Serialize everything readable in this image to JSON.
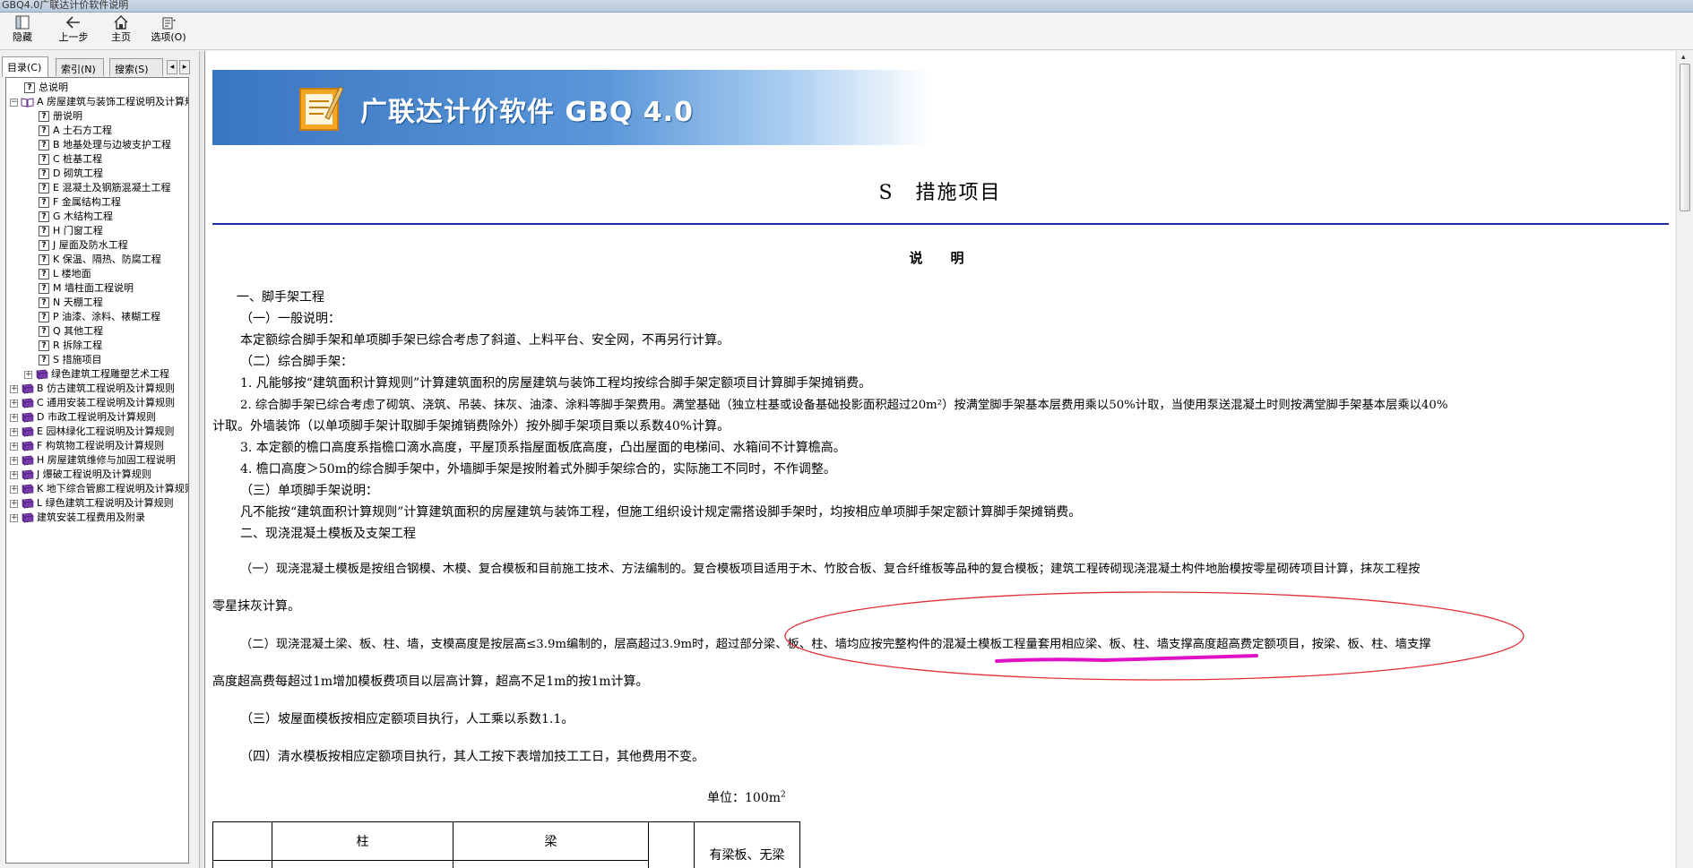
{
  "window": {
    "title": "GBQ4.0广联达计价软件说明"
  },
  "toolbar": {
    "hide_label": "隐藏",
    "back_label": "上一步",
    "home_label": "主页",
    "options_label": "选项(O)"
  },
  "left_tabs": {
    "contents": "目录(C)",
    "index": "索引(N)",
    "search": "搜索(S)"
  },
  "tree": [
    {
      "label": "总说明",
      "level": 1,
      "icon": "help-page-icon",
      "exp": ""
    },
    {
      "label": "A 房屋建筑与装饰工程说明及计算规则",
      "level": 0,
      "icon": "open-book-icon",
      "exp": "−"
    },
    {
      "label": "册说明",
      "level": 2,
      "icon": "help-page-icon",
      "exp": ""
    },
    {
      "label": "A 土石方工程",
      "level": 2,
      "icon": "help-page-icon",
      "exp": ""
    },
    {
      "label": "B 地基处理与边坡支护工程",
      "level": 2,
      "icon": "help-page-icon",
      "exp": ""
    },
    {
      "label": "C 桩基工程",
      "level": 2,
      "icon": "help-page-icon",
      "exp": ""
    },
    {
      "label": "D 砌筑工程",
      "level": 2,
      "icon": "help-page-icon",
      "exp": ""
    },
    {
      "label": "E 混凝土及钢筋混凝土工程",
      "level": 2,
      "icon": "help-page-icon",
      "exp": ""
    },
    {
      "label": "F 金属结构工程",
      "level": 2,
      "icon": "help-page-icon",
      "exp": ""
    },
    {
      "label": "G 木结构工程",
      "level": 2,
      "icon": "help-page-icon",
      "exp": ""
    },
    {
      "label": "H 门窗工程",
      "level": 2,
      "icon": "help-page-icon",
      "exp": ""
    },
    {
      "label": "J 屋面及防水工程",
      "level": 2,
      "icon": "help-page-icon",
      "exp": ""
    },
    {
      "label": "K 保温、隔热、防腐工程",
      "level": 2,
      "icon": "help-page-icon",
      "exp": ""
    },
    {
      "label": "L 楼地面",
      "level": 2,
      "icon": "help-page-icon",
      "exp": ""
    },
    {
      "label": "M 墙柱面工程说明",
      "level": 2,
      "icon": "help-page-icon",
      "exp": ""
    },
    {
      "label": "N 天棚工程",
      "level": 2,
      "icon": "help-page-icon",
      "exp": ""
    },
    {
      "label": "P 油漆、涂料、裱糊工程",
      "level": 2,
      "icon": "help-page-icon",
      "exp": ""
    },
    {
      "label": "Q 其他工程",
      "level": 2,
      "icon": "help-page-icon",
      "exp": ""
    },
    {
      "label": "R 拆除工程",
      "level": 2,
      "icon": "help-page-icon",
      "exp": ""
    },
    {
      "label": "S 措施项目",
      "level": 2,
      "icon": "help-page-icon",
      "exp": ""
    },
    {
      "label": "绿色建筑工程雕塑艺术工程",
      "level": 1,
      "icon": "closed-book-icon",
      "exp": "+"
    },
    {
      "label": "B 仿古建筑工程说明及计算规则",
      "level": 0,
      "icon": "closed-book-icon",
      "exp": "+"
    },
    {
      "label": "C 通用安装工程说明及计算规则",
      "level": 0,
      "icon": "closed-book-icon",
      "exp": "+"
    },
    {
      "label": "D 市政工程说明及计算规则",
      "level": 0,
      "icon": "closed-book-icon",
      "exp": "+"
    },
    {
      "label": "E 园林绿化工程说明及计算规则",
      "level": 0,
      "icon": "closed-book-icon",
      "exp": "+"
    },
    {
      "label": "F 构筑物工程说明及计算规则",
      "level": 0,
      "icon": "closed-book-icon",
      "exp": "+"
    },
    {
      "label": "H 房屋建筑维修与加固工程说明",
      "level": 0,
      "icon": "closed-book-icon",
      "exp": "+"
    },
    {
      "label": "J 爆破工程说明及计算规则",
      "level": 0,
      "icon": "closed-book-icon",
      "exp": "+"
    },
    {
      "label": "K 地下综合管廊工程说明及计算规则",
      "level": 0,
      "icon": "closed-book-icon",
      "exp": "+"
    },
    {
      "label": "L 绿色建筑工程说明及计算规则",
      "level": 0,
      "icon": "closed-book-icon",
      "exp": "+"
    },
    {
      "label": "建筑安装工程费用及附录",
      "level": 0,
      "icon": "closed-book-icon",
      "exp": "+"
    }
  ],
  "banner": {
    "text": "广联达计价软件 GBQ 4.0"
  },
  "doc": {
    "heading": "S　措施项目",
    "subheading": "说　明",
    "paragraphs": [
      "一、脚手架工程",
      "（一）一般说明：",
      "本定额综合脚手架和单项脚手架已综合考虑了斜道、上料平台、安全网，不再另行计算。",
      "（二）综合脚手架：",
      "1. 凡能够按“建筑面积计算规则”计算建筑面积的房屋建筑与装饰工程均按综合脚手架定额项目计算脚手架摊销费。",
      "2. 综合脚手架已综合考虑了砌筑、浇筑、吊装、抹灰、油漆、涂料等脚手架费用。满堂基础（独立柱基或设备基础投影面积超过20m²）按满堂脚手架基本层费用乘以50%计取，当使用泵送混凝土时则按满堂脚手架基本层乘以40%",
      "计取。外墙装饰（以单项脚手架计取脚手架摊销费除外）按外脚手架项目乘以系数40%计算。",
      "3. 本定额的檐口高度系指檐口滴水高度，平屋顶系指屋面板底高度，凸出屋面的电梯间、水箱间不计算檐高。",
      "4. 檐口高度＞50m的综合脚手架中，外墙脚手架是按附着式外脚手架综合的，实际施工不同时，不作调整。",
      "（三）单项脚手架说明：",
      "凡不能按“建筑面积计算规则”计算建筑面积的房屋建筑与装饰工程，但施工组织设计规定需搭设脚手架时，均按相应单项脚手架定额计算脚手架摊销费。",
      "二、现浇混凝土模板及支架工程",
      "（一）现浇混凝土模板是按组合钢模、木模、复合模板和目前施工技术、方法编制的。复合模板项目适用于木、竹胶合板、复合纤维板等品种的复合模板；建筑工程砖砌现浇混凝土构件地胎模按零星砌砖项目计算，抹灰工程按",
      "零星抹灰计算。",
      "（二）现浇混凝土梁、板、柱、墙，支模高度是按层高≤3.9m编制的，层高超过3.9m时，超过部分梁、板、柱、墙均应按完整构件的混凝土模板工程量套用相应梁、板、柱、墙支撑高度超高费定额项目，按梁、板、柱、墙支撑",
      "高度超高费每超过1m增加模板费项目以层高计算，超高不足1m的按1m计算。",
      "（三）坡屋面模板按相应定额项目执行，人工乘以系数1.1。",
      "（四）清水模板按相应定额项目执行，其人工按下表增加技工工日，其他费用不变。"
    ],
    "unit_label": "单位：100m",
    "unit_sup": "2",
    "table": {
      "col_zhu": "柱",
      "col_liang": "梁",
      "col_slab": "有梁板、无梁"
    }
  },
  "annotation": {
    "ellipse_color": "#e0303a",
    "underline_color": "#e010c8"
  }
}
